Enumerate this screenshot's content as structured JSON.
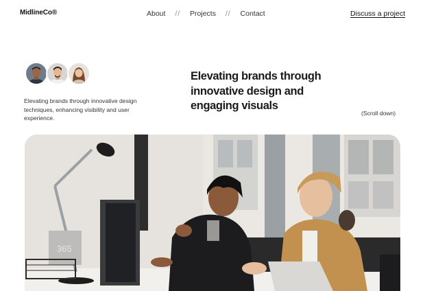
{
  "brand": {
    "name": "MidlineCo®"
  },
  "nav": {
    "items": [
      "About",
      "Projects",
      "Contact"
    ],
    "separator": "//",
    "cta": "Discuss a project"
  },
  "hero": {
    "intro": "Elevating brands through innovative design techniques, enhancing visibility and user experience.",
    "headline": "Elevating brands through innovative design and engaging visuals",
    "scroll_hint": "(Scroll down)",
    "lamp_base_text": "365"
  },
  "icons": [
    "avatar-1",
    "avatar-2",
    "avatar-3"
  ],
  "colors": {
    "text": "#1a1a1a",
    "background": "#ffffff"
  }
}
